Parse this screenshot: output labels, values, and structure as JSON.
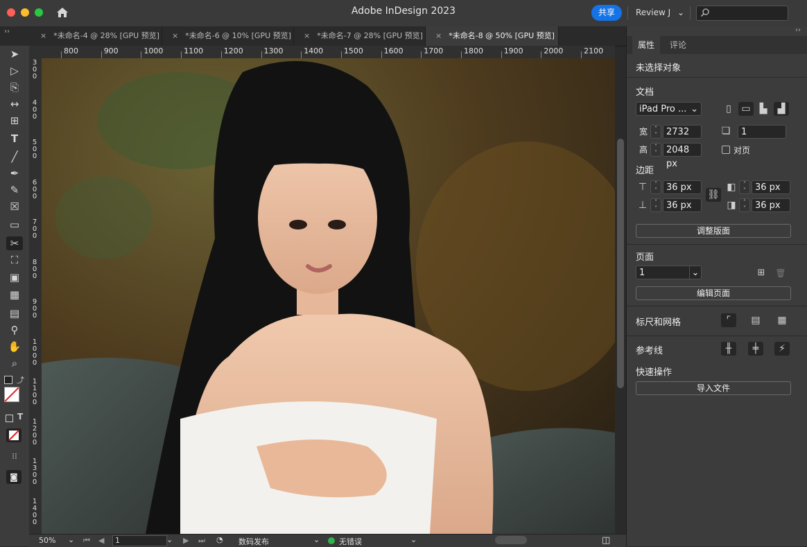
{
  "window": {
    "title": "Adobe InDesign 2023",
    "share_label": "共享",
    "review_label": "Review J",
    "search_placeholder": ""
  },
  "tabs": [
    {
      "label": "*未命名-4 @ 28% [GPU 预览]",
      "active": false
    },
    {
      "label": "*未命名-6 @ 10% [GPU 预览]",
      "active": false
    },
    {
      "label": "*未命名-7 @ 28% [GPU 预览]",
      "active": false
    },
    {
      "label": "*未命名-8 @ 50% [GPU 预览]",
      "active": true
    }
  ],
  "ruler": {
    "horizontal": [
      "800",
      "900",
      "1000",
      "1100",
      "1200",
      "1300",
      "1400",
      "1500",
      "1600",
      "1700",
      "1800",
      "1900",
      "2000",
      "2100"
    ],
    "vertical": [
      "300",
      "400",
      "500",
      "600",
      "700",
      "800",
      "900",
      "1000",
      "1100",
      "1200",
      "1300",
      "1400"
    ]
  },
  "status": {
    "zoom": "50%",
    "page": "1",
    "preflight_profile": "数码发布",
    "errors": "无错误"
  },
  "panel": {
    "tab_properties": "属性",
    "tab_comments": "评论",
    "no_selection": "未选择对象",
    "document_heading": "文档",
    "preset": "iPad Pro ...",
    "width_label": "宽",
    "width_value": "2732 px",
    "height_label": "高",
    "height_value": "2048 px",
    "pages_count": "1",
    "facing_pages_label": "对页",
    "margins_heading": "边距",
    "margin_top": "36 px",
    "margin_bottom": "36 px",
    "margin_inside": "36 px",
    "margin_outside": "36 px",
    "adjust_layout_button": "调整版面",
    "pages_heading": "页面",
    "page_select": "1",
    "edit_page_button": "编辑页面",
    "rulers_grids_heading": "标尺和网格",
    "guides_heading": "参考线",
    "quick_actions_heading": "快速操作",
    "import_file_button": "导入文件"
  },
  "colors": {
    "accent": "#1473e6",
    "panel_bg": "#3c3c3c",
    "status_ok": "#2fb34a"
  }
}
